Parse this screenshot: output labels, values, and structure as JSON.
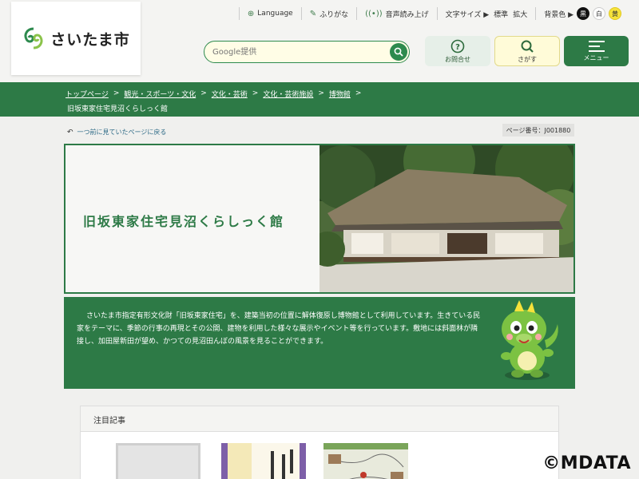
{
  "header": {
    "logo_text": "さいたま市",
    "language": "Language",
    "furigana": "ふりがな",
    "read_aloud": "音声読み上げ",
    "font_size_label": "文字サイズ ▶",
    "font_standard": "標準",
    "font_large": "拡大",
    "bg_color_label": "背景色 ▶",
    "bg_black": "黒",
    "bg_white": "白",
    "bg_yellow": "黄",
    "search_placeholder": "Google提供",
    "contact_label": "お問合せ",
    "find_label": "さがす",
    "menu_label": "メニュー"
  },
  "breadcrumb": {
    "items": [
      "トップページ",
      "観光・スポーツ・文化",
      "文化・芸術",
      "文化・芸術施設",
      "博物館"
    ],
    "separator": ">",
    "current": "旧坂東家住宅見沼くらしっく館"
  },
  "main": {
    "back_link": "一つ前に見ていたページに戻る",
    "page_number": "ページ番号：J001880",
    "hero_title": "旧坂東家住宅見沼くらしっく館",
    "description": "さいたま市指定有形文化財「旧坂東家住宅」を、建築当初の位置に解体復原し博物館として利用しています。生きている民家をテーマに、季節の行事の再現とその公開、建物を利用した様々な展示やイベント等を行っています。敷地には斜面林が隣接し、加田屋新田が望め、かつての見沼田んぼの風景を見ることができます。",
    "featured_title": "注目記事"
  },
  "watermark": "©MDATA",
  "colors": {
    "brand_green": "#2d7a46",
    "accent_yellow": "#fffbd8"
  }
}
